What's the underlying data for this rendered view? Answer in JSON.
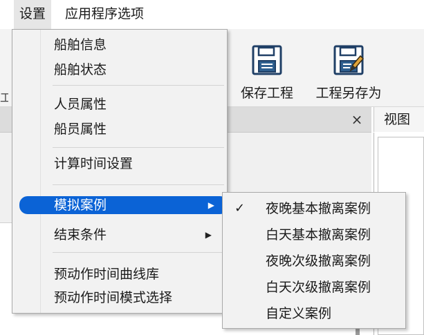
{
  "menubar": {
    "settings": "设置",
    "app_options": "应用程序选项"
  },
  "toolbar": {
    "save_project": "保存工程",
    "save_project_as": "工程另存为",
    "left_stub": "工"
  },
  "panel": {
    "close_glyph": "×",
    "view_tab": "视图"
  },
  "settings_menu": {
    "items": [
      {
        "label": "船舶信息"
      },
      {
        "label": "船舶状态"
      },
      {
        "label": "人员属性"
      },
      {
        "label": "船员属性"
      },
      {
        "label": "计算时间设置"
      },
      {
        "label": "模拟案例",
        "has_submenu": true,
        "highlighted": true
      },
      {
        "label": "结束条件",
        "has_submenu": true
      },
      {
        "label": "预动作时间曲线库"
      },
      {
        "label": "预动作时间模式选择"
      }
    ],
    "submenu_arrow": "▶"
  },
  "simulation_case_submenu": {
    "items": [
      {
        "label": "夜晚基本撤离案例",
        "checked": true
      },
      {
        "label": "白天基本撤离案例"
      },
      {
        "label": "夜晚次级撤离案例"
      },
      {
        "label": "白天次级撤离案例"
      },
      {
        "label": "自定义案例"
      }
    ],
    "check_glyph": "✓"
  },
  "colors": {
    "highlight": "#0b63d6",
    "menu_background": "#f2f2f2",
    "menubar_active": "#e6e6e6",
    "icon_blue": "#2f5f8f"
  },
  "icons": [
    "floppy-disk-icon",
    "floppy-disk-pen-icon",
    "close-icon",
    "checkmark-icon",
    "submenu-arrow-icon"
  ]
}
